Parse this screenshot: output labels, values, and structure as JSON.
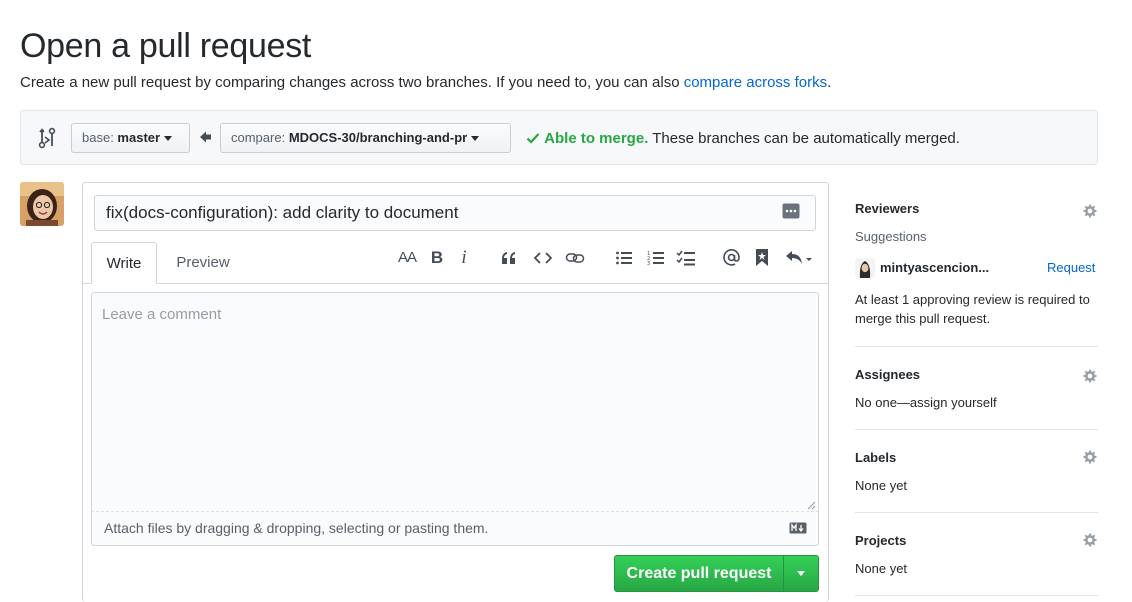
{
  "header": {
    "title": "Open a pull request",
    "subtitle": "Create a new pull request by comparing changes across two branches. If you need to, you can also ",
    "subtitle_link": "compare across forks",
    "subtitle_end": "."
  },
  "compare": {
    "base_prefix": "base: ",
    "base_branch": "master",
    "compare_prefix": "compare: ",
    "compare_branch": "MDOCS-30/branching-and-pr",
    "merge_ok": "Able to merge.",
    "merge_text": " These branches can be automatically merged."
  },
  "form": {
    "title_value": "fix(docs-configuration): add clarity to document",
    "tab_write": "Write",
    "tab_preview": "Preview",
    "toolbar": {
      "heading": "AA",
      "bold": "B",
      "italic": "i"
    },
    "comment_placeholder": "Leave a comment",
    "attach_text": "Attach files by dragging & dropping, selecting or pasting them.",
    "create_label": "Create pull request"
  },
  "sidebar": {
    "reviewers": {
      "heading": "Reviewers",
      "suggestions": "Suggestions",
      "suggested_user": "mintyascencion...",
      "request_label": "Request",
      "note": "At least 1 approving review is required to merge this pull request."
    },
    "assignees": {
      "heading": "Assignees",
      "text": "No one—assign yourself"
    },
    "labels": {
      "heading": "Labels",
      "text": "None yet"
    },
    "projects": {
      "heading": "Projects",
      "text": "None yet"
    }
  },
  "colors": {
    "link": "#0366d6",
    "success": "#28a745",
    "primary_button": "#2ea44f"
  },
  "icons": [
    "compare-arrows-icon",
    "arrow-left-icon",
    "check-icon",
    "saved-reply-icon",
    "heading-icon",
    "bold-icon",
    "italic-icon",
    "quote-icon",
    "code-icon",
    "link-icon",
    "unordered-list-icon",
    "ordered-list-icon",
    "task-list-icon",
    "mention-icon",
    "bookmark-icon",
    "reply-icon",
    "markdown-icon",
    "gear-icon",
    "caret-down-icon"
  ]
}
